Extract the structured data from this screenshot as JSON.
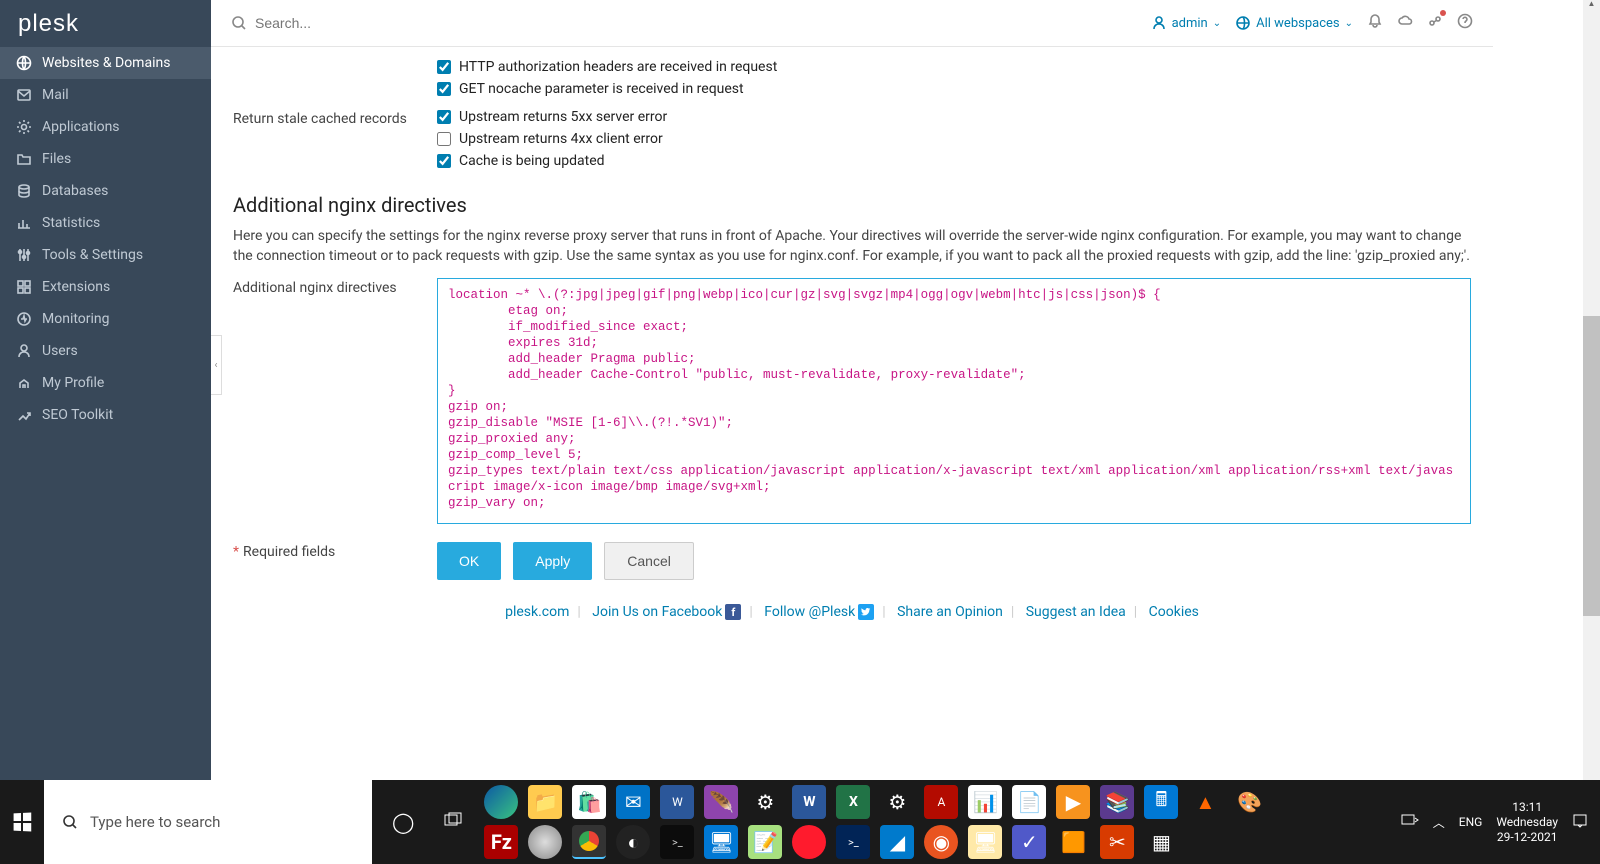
{
  "brand": "plesk",
  "search_placeholder": "Search...",
  "header": {
    "user": "admin",
    "scope": "All webspaces"
  },
  "sidebar": {
    "items": [
      {
        "label": "Websites & Domains"
      },
      {
        "label": "Mail"
      },
      {
        "label": "Applications"
      },
      {
        "label": "Files"
      },
      {
        "label": "Databases"
      },
      {
        "label": "Statistics"
      },
      {
        "label": "Tools & Settings"
      },
      {
        "label": "Extensions"
      },
      {
        "label": "Monitoring"
      },
      {
        "label": "Users"
      },
      {
        "label": "My Profile"
      },
      {
        "label": "SEO Toolkit"
      }
    ]
  },
  "form": {
    "bypass_opts": {
      "http_auth": "HTTP authorization headers are received in request",
      "get_nocache": "GET nocache parameter is received in request"
    },
    "stale_label": "Return stale cached records",
    "stale_opts": {
      "err5xx": "Upstream returns 5xx server error",
      "err4xx": "Upstream returns 4xx client error",
      "updating": "Cache is being updated"
    },
    "directives_heading": "Additional nginx directives",
    "directives_desc": "Here you can specify the settings for the nginx reverse proxy server that runs in front of Apache. Your directives will override the server-wide nginx configuration. For example, you may want to change the connection timeout or to pack requests with gzip. Use the same syntax as you use for nginx.conf. For example, if you want to pack all the proxied requests with gzip, add the line: 'gzip_proxied any;'.",
    "directives_label": "Additional nginx directives",
    "directives_value": "location ~* \\.(?:jpg|jpeg|gif|png|webp|ico|cur|gz|svg|svgz|mp4|ogg|ogv|webm|htc|js|css|json)$ {\n        etag on;\n        if_modified_since exact;\n        expires 31d;\n        add_header Pragma public;\n        add_header Cache-Control \"public, must-revalidate, proxy-revalidate\";\n}\ngzip on;\ngzip_disable \"MSIE [1-6]\\\\.(?!.*SV1)\";\ngzip_proxied any;\ngzip_comp_level 5;\ngzip_types text/plain text/css application/javascript application/x-javascript text/xml application/xml application/rss+xml text/javascript image/x-icon image/bmp image/svg+xml;\ngzip_vary on;",
    "required_label": "Required fields",
    "btn_ok": "OK",
    "btn_apply": "Apply",
    "btn_cancel": "Cancel"
  },
  "footer": {
    "plesk": "plesk.com",
    "fb": "Join Us on Facebook",
    "tw": "Follow @Plesk",
    "opinion": "Share an Opinion",
    "idea": "Suggest an Idea",
    "cookies": "Cookies"
  },
  "taskbar": {
    "search_placeholder": "Type here to search",
    "lang": "ENG",
    "time": "13:11",
    "day": "Wednesday",
    "date": "29-12-2021"
  }
}
